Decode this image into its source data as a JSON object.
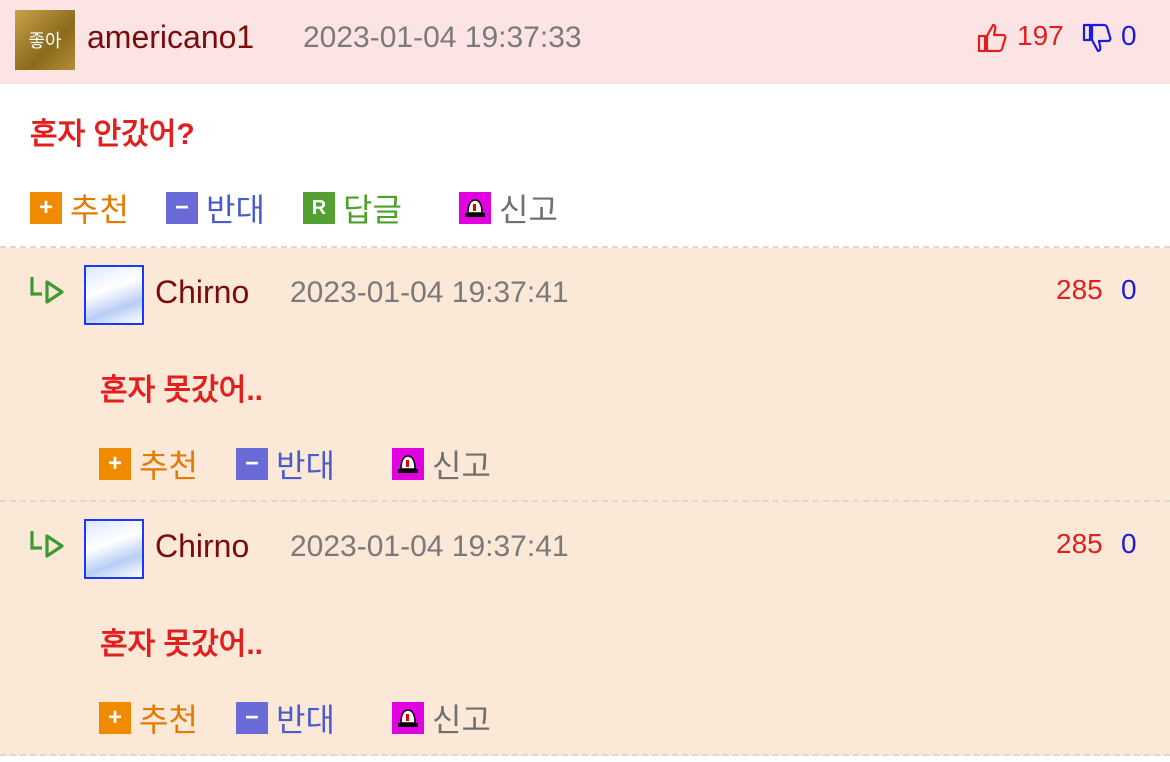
{
  "main_comment": {
    "avatar_text": "좋아",
    "username": "americano1",
    "date": "2023-01-04 19:37:33",
    "up_count": "197",
    "down_count": "0",
    "content": "혼자 안갔어?",
    "actions": {
      "recommend": "추천",
      "oppose": "반대",
      "reply": "답글",
      "report": "신고"
    }
  },
  "replies": [
    {
      "username": "Chirno",
      "date": "2023-01-04 19:37:41",
      "up_count": "285",
      "down_count": "0",
      "content": "혼자 못갔어..",
      "actions": {
        "recommend": "추천",
        "oppose": "반대",
        "report": "신고"
      }
    },
    {
      "username": "Chirno",
      "date": "2023-01-04 19:37:41",
      "up_count": "285",
      "down_count": "0",
      "content": "혼자 못갔어..",
      "actions": {
        "recommend": "추천",
        "oppose": "반대",
        "report": "신고"
      }
    }
  ],
  "colors": {
    "header_bg": "#fde4e4",
    "reply_bg": "#fbe8d7",
    "username": "#7a0b0b",
    "content": "#e0201f",
    "up": "#e02020",
    "down": "#1a1ae0"
  }
}
